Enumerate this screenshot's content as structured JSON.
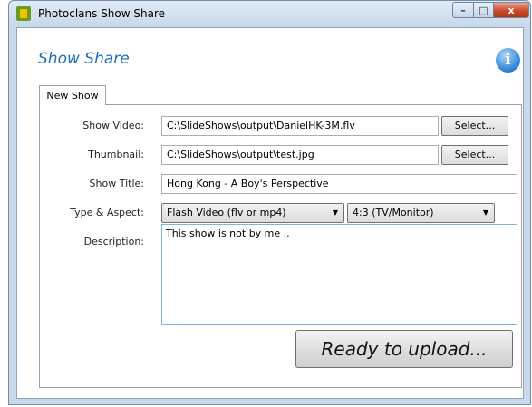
{
  "window": {
    "title": "Photoclans Show Share",
    "controls": {
      "minimize": "–",
      "maximize": "□",
      "close": "x"
    }
  },
  "header": {
    "heading": "Show Share",
    "info_icon": "i"
  },
  "tabs": [
    {
      "label": "New Show",
      "selected": true
    }
  ],
  "form": {
    "show_video": {
      "label": "Show Video:",
      "value": "C:\\SlideShows\\output\\DanielHK-3M.flv",
      "button": "Select..."
    },
    "thumbnail": {
      "label": "Thumbnail:",
      "value": "C:\\SlideShows\\output\\test.jpg",
      "button": "Select..."
    },
    "show_title": {
      "label": "Show Title:",
      "value": "Hong Kong - A Boy's Perspective"
    },
    "type_aspect": {
      "label": "Type & Aspect:",
      "type_value": "Flash Video (flv or mp4)",
      "aspect_value": "4:3  (TV/Monitor)"
    },
    "description": {
      "label": "Description:",
      "value": "This show is not by me .."
    }
  },
  "actions": {
    "upload_label": "Ready to upload..."
  },
  "colors": {
    "heading": "#1e6fb5",
    "info_icon": "#2e7fd3",
    "close_button": "#c94a2a"
  }
}
